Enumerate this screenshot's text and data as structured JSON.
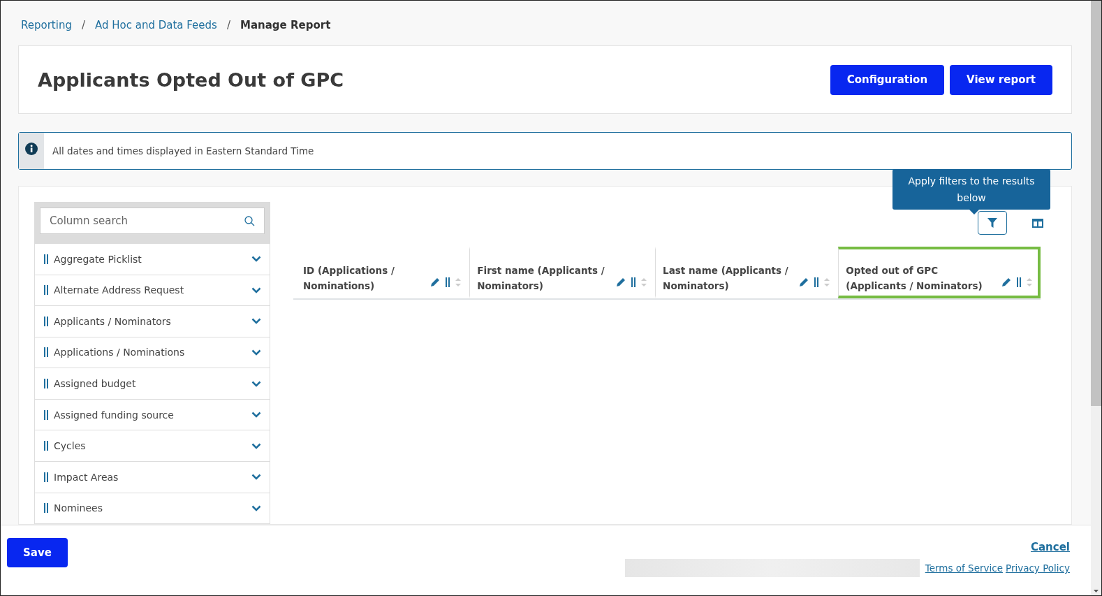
{
  "breadcrumbs": [
    {
      "label": "Reporting",
      "current": false
    },
    {
      "separator": "/",
      "label": "Ad Hoc and Data Feeds",
      "current": false
    },
    {
      "separator": "/",
      "label": "Manage Report",
      "current": true
    }
  ],
  "page_title": "Applicants Opted Out of GPC",
  "header_buttons": [
    "Configuration",
    "View report"
  ],
  "info_message": "All dates and times displayed in Eastern Standard Time",
  "column_search": {
    "placeholder": "Column search"
  },
  "categories": [
    {
      "label": "Aggregate Picklist",
      "expanded": false
    },
    {
      "label": "Alternate Address Request",
      "expanded": false
    },
    {
      "label": "Applicants / Nominators",
      "expanded": false
    },
    {
      "label": "Applications / Nominations",
      "expanded": false
    },
    {
      "label": "Assigned budget",
      "expanded": false
    },
    {
      "label": "Assigned funding source",
      "expanded": false
    },
    {
      "label": "Cycles",
      "expanded": false
    },
    {
      "label": "Impact Areas",
      "expanded": false
    },
    {
      "label": "Nominees",
      "expanded": false
    }
  ],
  "tooltip": "Apply filters to the results below",
  "columns": [
    {
      "label": "ID (Applications / Nominations)",
      "highlighted": false
    },
    {
      "label": "First name (Applicants / Nominators)",
      "highlighted": false
    },
    {
      "label": "Last name (Applicants / Nominators)",
      "highlighted": false
    },
    {
      "label": "Opted out of GPC (Applicants / Nominators)",
      "highlighted": true
    }
  ],
  "footer": {
    "save": "Save",
    "cancel": "Cancel",
    "links": [
      "Terms of Service",
      "Privacy Policy"
    ]
  }
}
